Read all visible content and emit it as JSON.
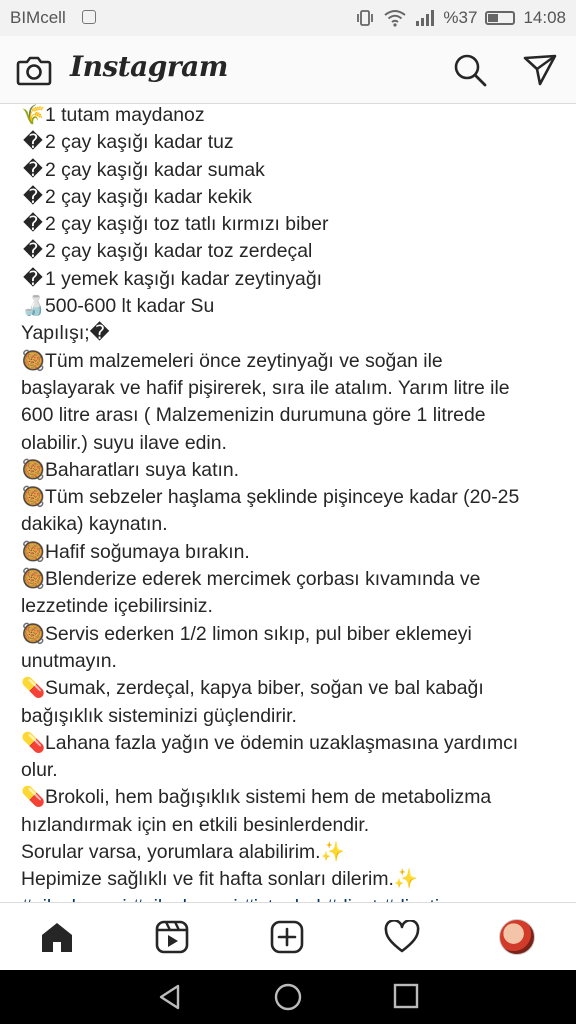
{
  "status_bar": {
    "carrier": "BIMcell",
    "battery_text": "%37",
    "battery_level": 0.37,
    "time": "14:08"
  },
  "app": {
    "name": "Instagram"
  },
  "caption_lines": [
    {
      "emoji": "🌾",
      "text": "1 tutam maydanoz"
    },
    {
      "emoji": "�",
      "text": "2 çay kaşığı kadar tuz"
    },
    {
      "emoji": "�",
      "text": "2 çay kaşığı kadar sumak"
    },
    {
      "emoji": "�",
      "text": "2 çay kaşığı kadar kekik"
    },
    {
      "emoji": "�",
      "text": "2 çay kaşığı toz tatlı kırmızı biber"
    },
    {
      "emoji": "�",
      "text": "2 çay kaşığı kadar toz zerdeçal"
    },
    {
      "emoji": "�",
      "text": "1 yemek kaşığı kadar zeytinyağı"
    },
    {
      "emoji": "🍶",
      "text": "500-600 lt kadar Su"
    },
    {
      "emoji": "",
      "text": "Yapılışı;�"
    },
    {
      "emoji": "🥘",
      "text": "Tüm malzemeleri önce zeytinyağı ve soğan ile başlayarak ve hafif pişirerek, sıra ile atalım. Yarım litre ile 600 litre arası ( Malzemenizin durumuna göre 1 litrede olabilir.) suyu ilave edin."
    },
    {
      "emoji": "🥘",
      "text": "Baharatları suya katın."
    },
    {
      "emoji": "🥘",
      "text": "Tüm sebzeler haşlama şeklinde pişinceye kadar (20-25 dakika) kaynatın."
    },
    {
      "emoji": "🥘",
      "text": "Hafif soğumaya bırakın."
    },
    {
      "emoji": "🥘",
      "text": "Blenderize ederek mercimek çorbası kıvamında ve lezzetinde içebilirsiniz."
    },
    {
      "emoji": "🥘",
      "text": "Servis ederken 1/2 limon sıkıp, pul biber eklemeyi unutmayın."
    },
    {
      "emoji": "💊",
      "text": "Sumak, zerdeçal, kapya biber, soğan ve bal kabağı bağışıklık sisteminizi güçlendirir."
    },
    {
      "emoji": "💊",
      "text": "Lahana fazla yağın ve ödemin uzaklaşmasına yardımcı olur."
    },
    {
      "emoji": "💊",
      "text": "Brokoli, hem bağışıklık sistemi hem de metabolizma hızlandırmak için en etkili besinlerdendir."
    },
    {
      "emoji": "",
      "text": "Sorular varsa, yorumlara alabilirim.✨"
    },
    {
      "emoji": "",
      "text": "Hepimize sağlıklı ve fit hafta sonları dilerim.✨"
    }
  ],
  "hashtags": "#nilaykocaci #nilaykocaci #istanbul #diyet #diyetisyen",
  "bottom_nav": [
    "home-icon",
    "reels-icon",
    "new-post-icon",
    "activity-heart-icon",
    "profile-avatar"
  ],
  "system_nav": [
    "back-icon",
    "home-circle-icon",
    "recents-icon"
  ]
}
